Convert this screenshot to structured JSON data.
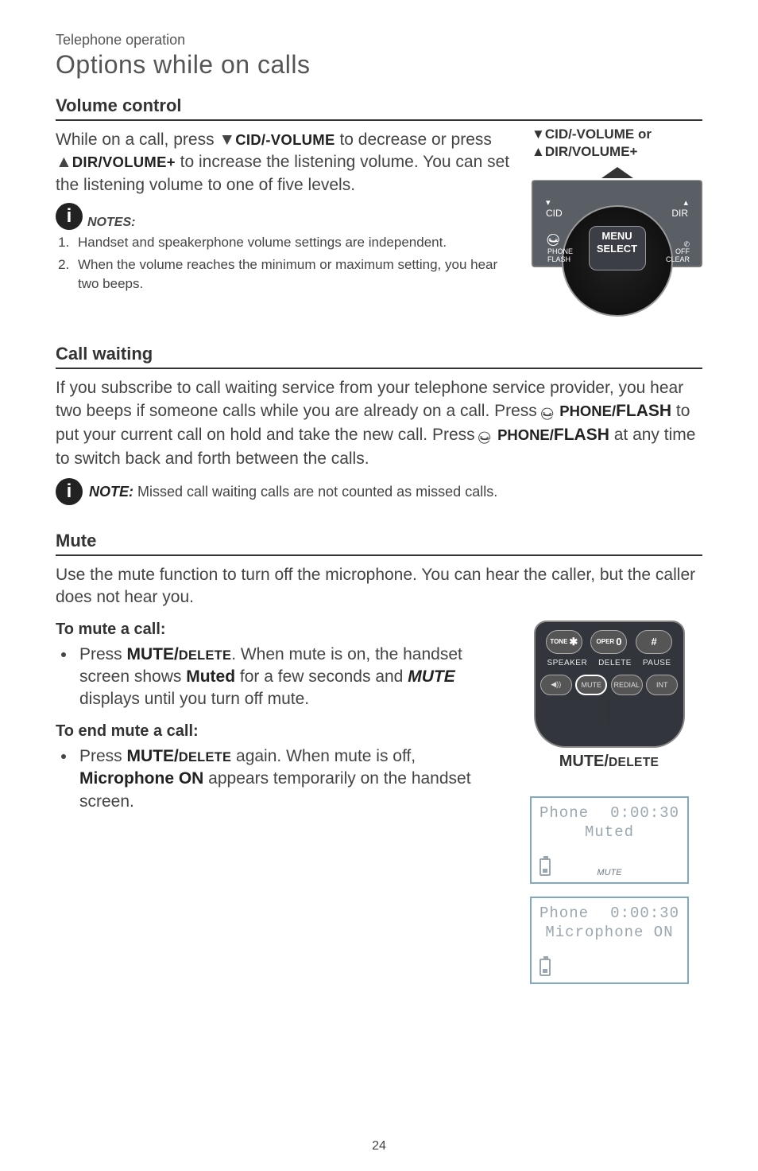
{
  "header": {
    "category": "Telephone operation",
    "title": "Options while on calls"
  },
  "volume": {
    "heading": "Volume control",
    "para_1": "While on a call, press ",
    "cid_btn": "CID/-VOLUME",
    "para_2": " to decrease or press ",
    "dir_btn": "DIR/VOLUME+",
    "para_3": " to increase the listening volume. You can set the listening volume to one of five levels.",
    "caption_1": "CID/-VOLUME",
    "caption_or": " or",
    "caption_2": "DIR/VOLUME+",
    "notes_label": "NOTES:",
    "note1": "Handset and speakerphone volume settings are independent.",
    "note2": "When the volume reaches the minimum or maximum setting, you hear two beeps."
  },
  "base_illustration": {
    "cid": "CID",
    "dir": "DIR",
    "menu": "MENU",
    "select": "SELECT",
    "phone": "PHONE",
    "flash": "FLASH",
    "off": "OFF",
    "clear": "CLEAR"
  },
  "callwaiting": {
    "heading": "Call waiting",
    "para_a": "If you subscribe to call waiting service from your telephone service provider, you hear two beeps if someone calls while you are already on a call. Press ",
    "btn": "PHONE/FLASH",
    "para_b": " to put your current call on hold and take the new call. Press ",
    "para_c": " at any time to switch back and forth between the calls.",
    "note_label": "NOTE:",
    "note_text": " Missed call waiting calls are not counted as missed calls."
  },
  "mute": {
    "heading": "Mute",
    "intro": "Use the mute function to turn off the microphone. You can hear the caller, but the caller does not hear you.",
    "sub1": "To mute a call:",
    "bullet1_a": "Press ",
    "bullet1_btn": "MUTE/DELETE",
    "bullet1_b": ". When mute is on, the handset screen shows ",
    "bullet1_bold1": "Muted",
    "bullet1_c": " for a few seconds and ",
    "bullet1_bold2": "MUTE",
    "bullet1_d": " displays until you turn off mute.",
    "sub2": "To end mute a call:",
    "bullet2_a": "Press ",
    "bullet2_b": " again. When mute is off, ",
    "bullet2_bold": "Microphone ON",
    "bullet2_c": " appears temporarily on the handset screen.",
    "caption": "MUTE/DELETE"
  },
  "handset_keys": {
    "star": "TONE ✱",
    "zero": "OPER 0",
    "hash": "#",
    "speaker": "SPEAKER",
    "delete": "DELETE",
    "pause": "PAUSE",
    "spk_icon": "◀))",
    "mute": "MUTE",
    "redial": "REDIAL",
    "int": "INT"
  },
  "lcd1": {
    "left": "Phone",
    "right": "0:00:30",
    "line2": "Muted",
    "softkey": "MUTE"
  },
  "lcd2": {
    "left": "Phone",
    "right": "0:00:30",
    "line2": "Microphone ON"
  },
  "page": "24"
}
